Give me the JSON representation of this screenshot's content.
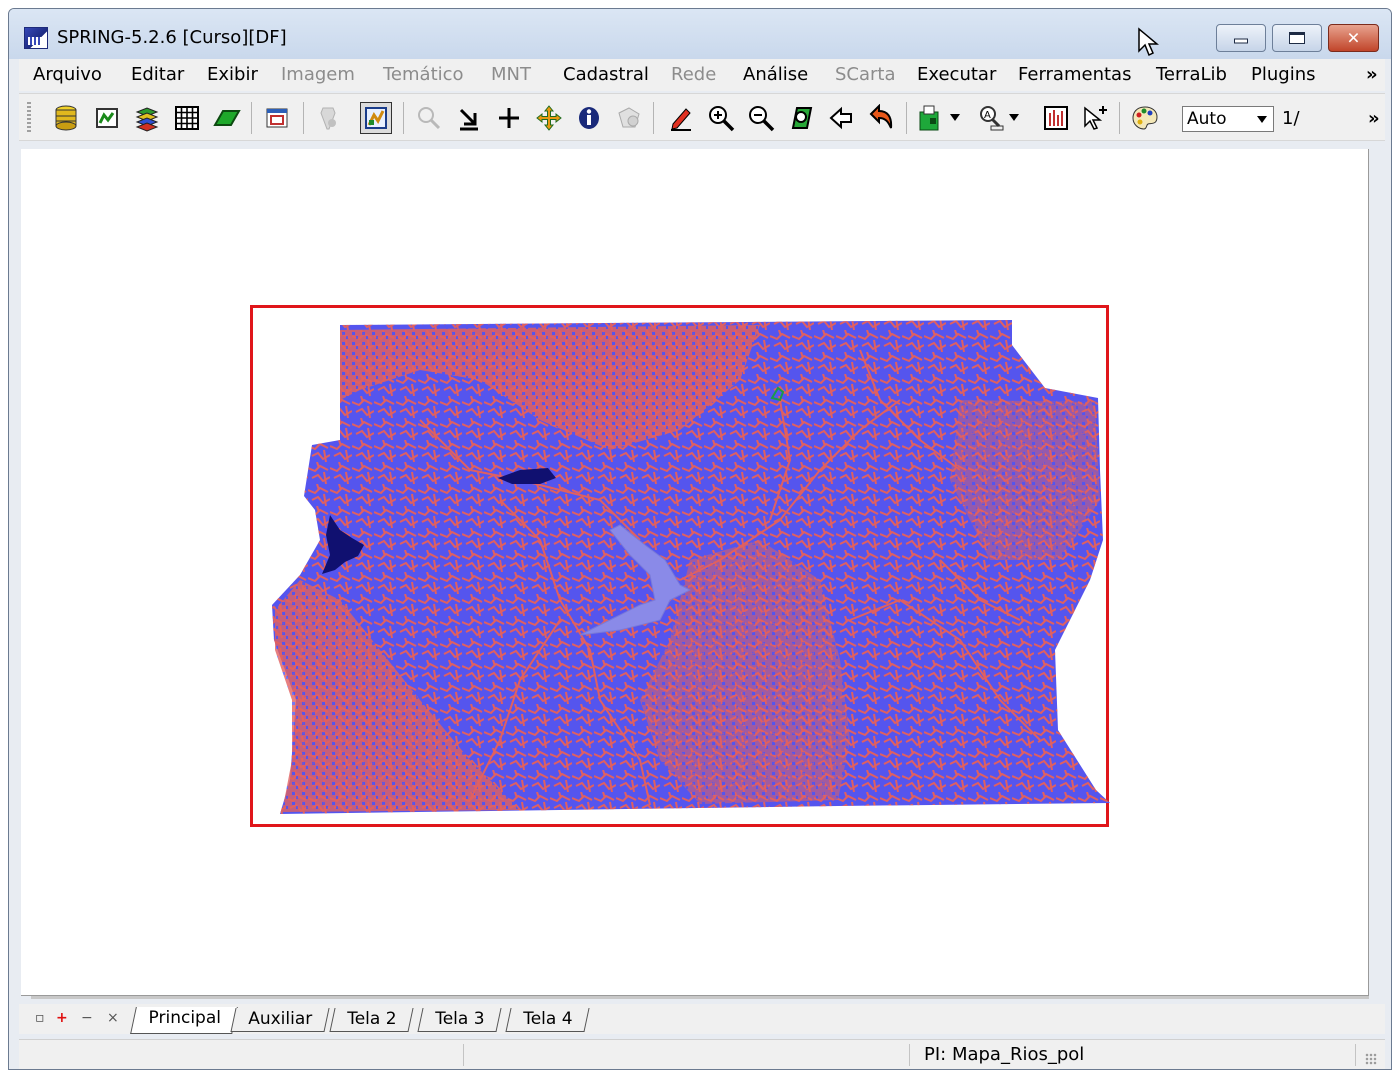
{
  "window": {
    "title": "SPRING-5.2.6 [Curso][DF]",
    "controls": {
      "minimize": "minimize",
      "maximize": "maximize",
      "close": "✕"
    }
  },
  "menu": {
    "items": [
      {
        "label": "Arquivo",
        "enabled": true
      },
      {
        "label": "Editar",
        "enabled": true
      },
      {
        "label": "Exibir",
        "enabled": true
      },
      {
        "label": "Imagem",
        "enabled": false
      },
      {
        "label": "Temático",
        "enabled": false
      },
      {
        "label": "MNT",
        "enabled": false
      },
      {
        "label": "Cadastral",
        "enabled": true
      },
      {
        "label": "Rede",
        "enabled": false
      },
      {
        "label": "Análise",
        "enabled": true
      },
      {
        "label": "SCarta",
        "enabled": false
      },
      {
        "label": "Executar",
        "enabled": true
      },
      {
        "label": "Ferramentas",
        "enabled": true
      },
      {
        "label": "TerraLib",
        "enabled": true
      },
      {
        "label": "Plugins",
        "enabled": true
      }
    ],
    "overflow": "»"
  },
  "toolbar": {
    "icons": [
      "database-icon",
      "model-icon",
      "layers-icon",
      "grid-icon",
      "plane-icon",
      "window-icon",
      "tool-icon",
      "draw-icon",
      "search-icon",
      "select-icon",
      "cursor-cross-icon",
      "pan-icon",
      "info-icon",
      "magic-icon",
      "pencil-icon",
      "zoom-in-icon",
      "zoom-out-icon",
      "zoom-area-icon",
      "back-icon",
      "undo-icon",
      "display-icon",
      "find-icon",
      "chart-icon",
      "pointer-plus-icon",
      "palette-icon"
    ],
    "scale": {
      "value": "Auto",
      "ratio": "1/"
    },
    "overflow": "»"
  },
  "map": {
    "frame_color": "#e0161a",
    "background_color": "#5555ee",
    "rivers_color": "#e06060",
    "lake_color": "#8a8ae8",
    "dark_water_color": "#101070"
  },
  "tabs": {
    "controls": [
      "▫",
      "+",
      "−",
      "×"
    ],
    "items": [
      {
        "label": "Principal",
        "active": true
      },
      {
        "label": "Auxiliar",
        "active": false
      },
      {
        "label": "Tela 2",
        "active": false
      },
      {
        "label": "Tela 3",
        "active": false
      },
      {
        "label": "Tela 4",
        "active": false
      }
    ]
  },
  "status": {
    "plan": "PI: Mapa_Rios_pol"
  }
}
